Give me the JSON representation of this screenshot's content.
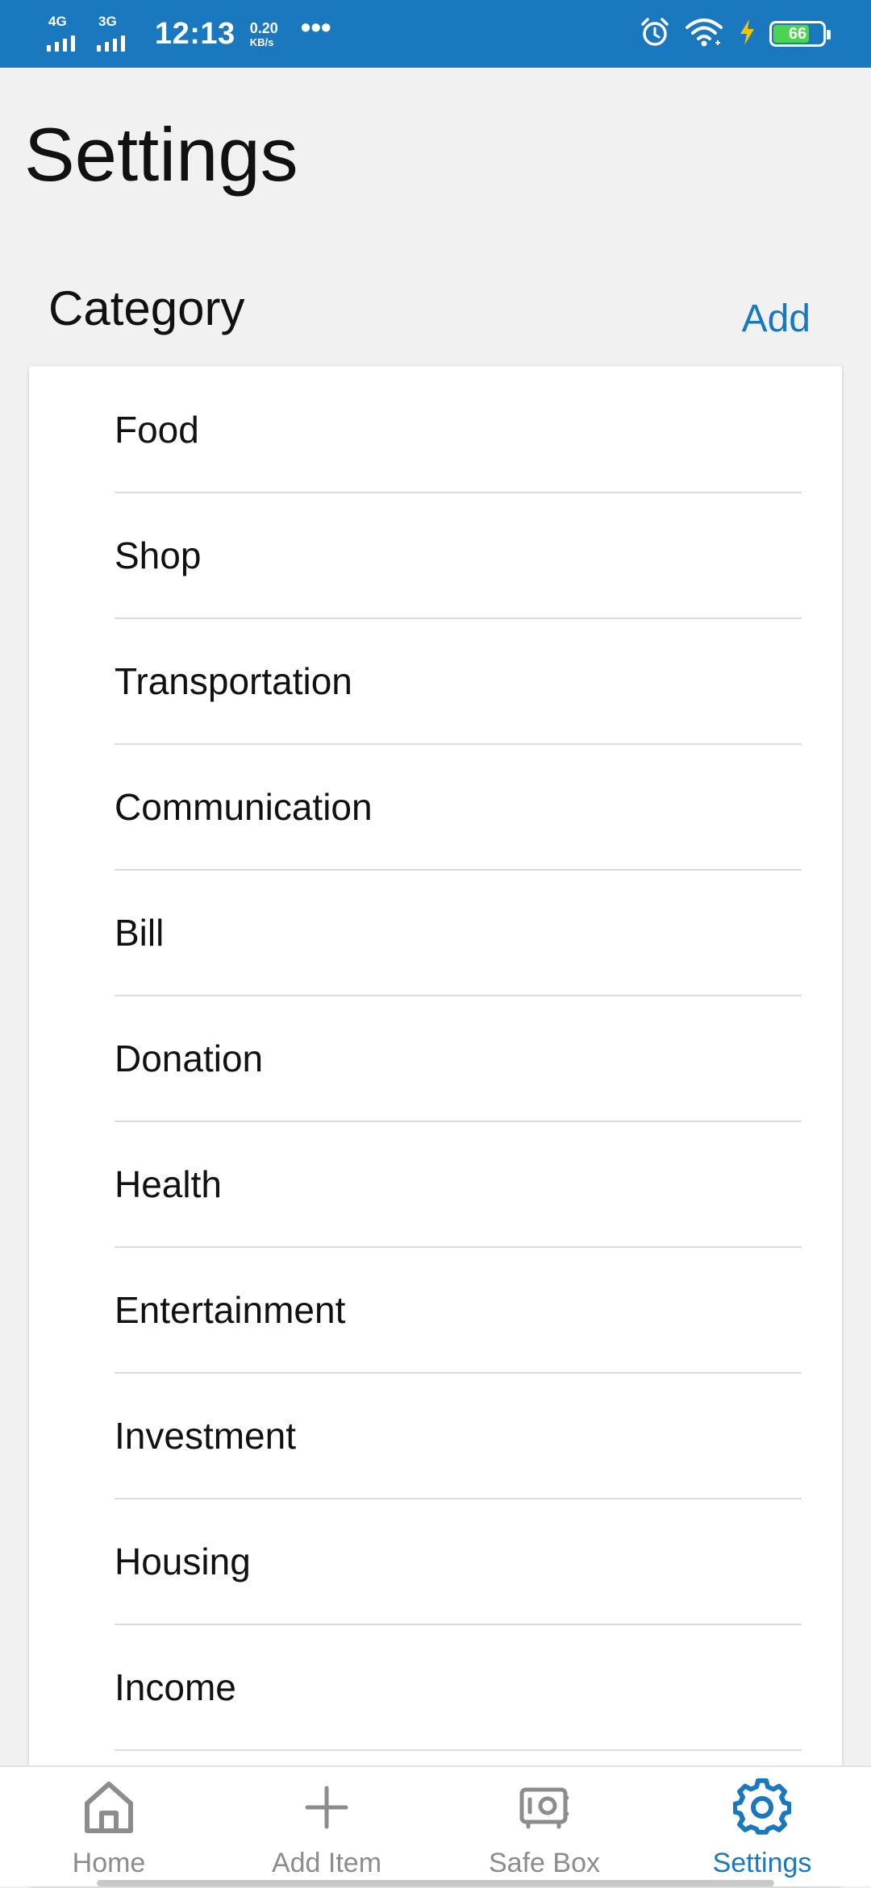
{
  "status_bar": {
    "network1": "4G",
    "network2": "3G",
    "time": "12:13",
    "speed_value": "0.20",
    "speed_unit": "KB/s",
    "more": "•••",
    "battery": "66",
    "icons": [
      "signal-4g-icon",
      "signal-3g-icon",
      "alarm-icon",
      "wifi-icon",
      "charging-icon",
      "battery-icon"
    ]
  },
  "page": {
    "title": "Settings"
  },
  "category_section": {
    "title": "Category",
    "add_label": "Add",
    "items": [
      {
        "label": "Food"
      },
      {
        "label": "Shop"
      },
      {
        "label": "Transportation"
      },
      {
        "label": "Communication"
      },
      {
        "label": "Bill"
      },
      {
        "label": "Donation"
      },
      {
        "label": "Health"
      },
      {
        "label": "Entertainment"
      },
      {
        "label": "Investment"
      },
      {
        "label": "Housing"
      },
      {
        "label": "Income"
      }
    ]
  },
  "bottom_nav": {
    "items": [
      {
        "label": "Home",
        "icon": "home-icon",
        "active": false
      },
      {
        "label": "Add Item",
        "icon": "plus-icon",
        "active": false
      },
      {
        "label": "Safe Box",
        "icon": "safe-icon",
        "active": false
      },
      {
        "label": "Settings",
        "icon": "gear-icon",
        "active": true
      }
    ]
  },
  "colors": {
    "accent": "#1a78be",
    "status_bar": "#1a78be",
    "inactive": "#8c8c8c",
    "battery_fill": "#4cd44f",
    "charging_bolt": "#f5c400"
  }
}
